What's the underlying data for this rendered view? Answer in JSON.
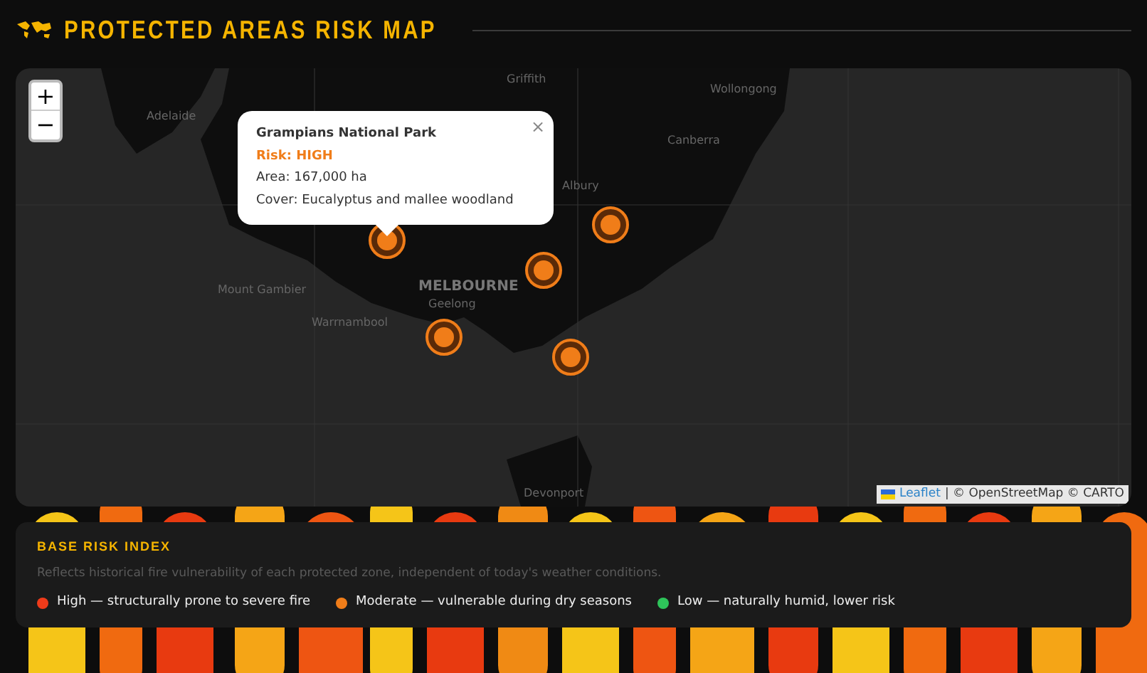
{
  "header": {
    "title": "PROTECTED AREAS RISK MAP"
  },
  "map": {
    "zoom_in": "+",
    "zoom_out": "−",
    "cities": [
      {
        "name": "Griffith",
        "major": false
      },
      {
        "name": "Wollongong",
        "major": false
      },
      {
        "name": "Adelaide",
        "major": false
      },
      {
        "name": "Canberra",
        "major": false
      },
      {
        "name": "Albury",
        "major": false
      },
      {
        "name": "Mount Gambier",
        "major": false
      },
      {
        "name": "MELBOURNE",
        "major": true
      },
      {
        "name": "Geelong",
        "major": false
      },
      {
        "name": "Warrnambool",
        "major": false
      },
      {
        "name": "Devonport",
        "major": false
      }
    ],
    "popup": {
      "close": "×",
      "title": "Grampians National Park",
      "risk": "Risk: HIGH",
      "area": "Area: 167,000 ha",
      "cover": "Cover: Eucalyptus and mallee woodland"
    },
    "attribution": {
      "link": "Leaflet",
      "text": "| © OpenStreetMap © CARTO"
    }
  },
  "legend": {
    "title": "BASE RISK INDEX",
    "description": "Reflects historical fire vulnerability of each protected zone, independent of today's weather conditions.",
    "items": [
      {
        "label": "High — structurally prone to severe fire",
        "color": "#ef3b1a"
      },
      {
        "label": "Moderate — vulnerable during dry seasons",
        "color": "#f07d19"
      },
      {
        "label": "Low — naturally humid, lower risk",
        "color": "#2ec45a"
      }
    ]
  }
}
